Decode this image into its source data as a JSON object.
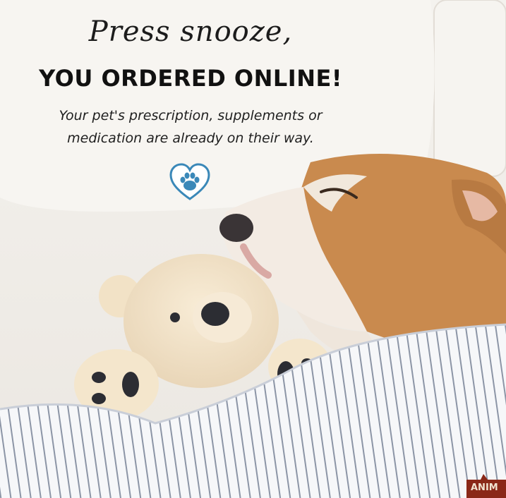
{
  "card": {
    "script_line": "Press snooze,",
    "headline": "YOU ORDERED ONLINE!",
    "subtext_line1": "Your pet's prescription, supplements or",
    "subtext_line2": "medication are already on their way.",
    "icon": "paw-heart-icon",
    "brand_badge_text": "ANIM"
  },
  "colors": {
    "background": "#f3f0ec",
    "accent_blue": "#3a88b8",
    "dog_tan": "#c98a4e",
    "badge_red": "#8a2818"
  }
}
